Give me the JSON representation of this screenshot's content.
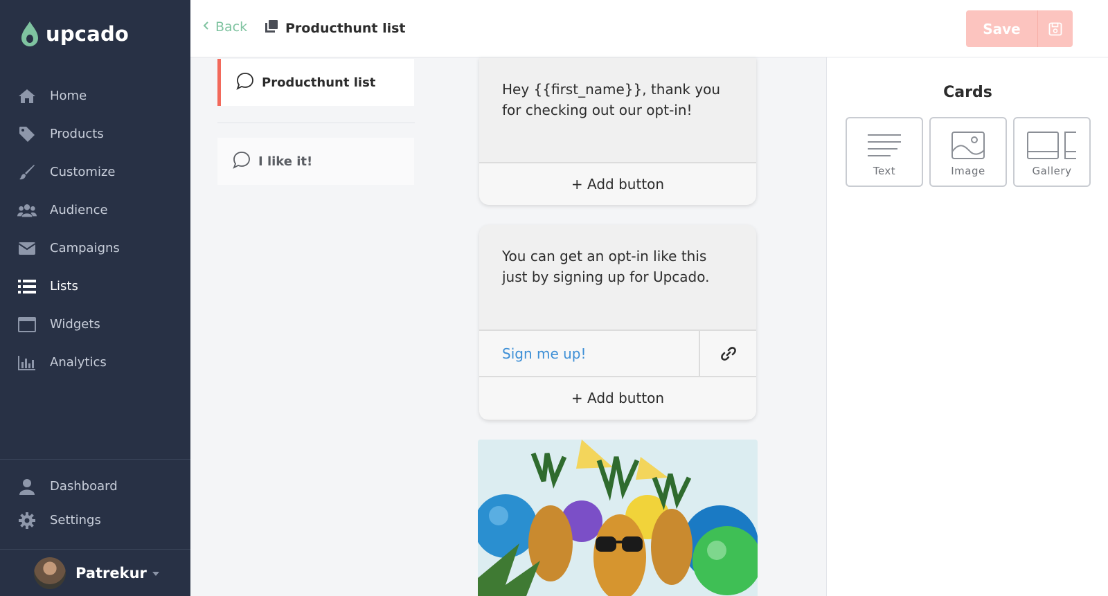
{
  "app": {
    "name": "upcado"
  },
  "sidebar": {
    "items": [
      {
        "label": "Home",
        "icon": "home-icon"
      },
      {
        "label": "Products",
        "icon": "tag-icon"
      },
      {
        "label": "Customize",
        "icon": "brush-icon"
      },
      {
        "label": "Audience",
        "icon": "users-icon"
      },
      {
        "label": "Campaigns",
        "icon": "envelope-icon"
      },
      {
        "label": "Lists",
        "icon": "list-icon",
        "active": true
      },
      {
        "label": "Widgets",
        "icon": "window-icon"
      },
      {
        "label": "Analytics",
        "icon": "bar-chart-icon"
      }
    ],
    "bottom_items": [
      {
        "label": "Dashboard",
        "icon": "user-icon"
      },
      {
        "label": "Settings",
        "icon": "gear-icon"
      }
    ],
    "user": {
      "name": "Patrekur"
    }
  },
  "header": {
    "back_label": "Back",
    "title": "Producthunt list",
    "save_label": "Save"
  },
  "messages": [
    {
      "label": "Producthunt list",
      "active": true
    },
    {
      "label": "I like it!",
      "active": false
    }
  ],
  "canvas": {
    "card1": {
      "text": "Hey {{first_name}}, thank you for checking out our opt-in!",
      "add_button": "+ Add button"
    },
    "card2": {
      "text": "You can get an opt-in like this just by signing up for Upcado.",
      "link_button": "Sign me up!",
      "add_button": "+ Add button"
    },
    "image_alt": "pineapples-party-image"
  },
  "right_panel": {
    "title": "Cards",
    "card_types": [
      {
        "label": "Text"
      },
      {
        "label": "Image"
      },
      {
        "label": "Gallery"
      }
    ]
  },
  "colors": {
    "sidebar_bg": "#283145",
    "accent_green": "#7fc3a0",
    "active_red": "#f2695b",
    "save_disabled": "#fcc4bf",
    "link_blue": "#3d8fd6"
  }
}
